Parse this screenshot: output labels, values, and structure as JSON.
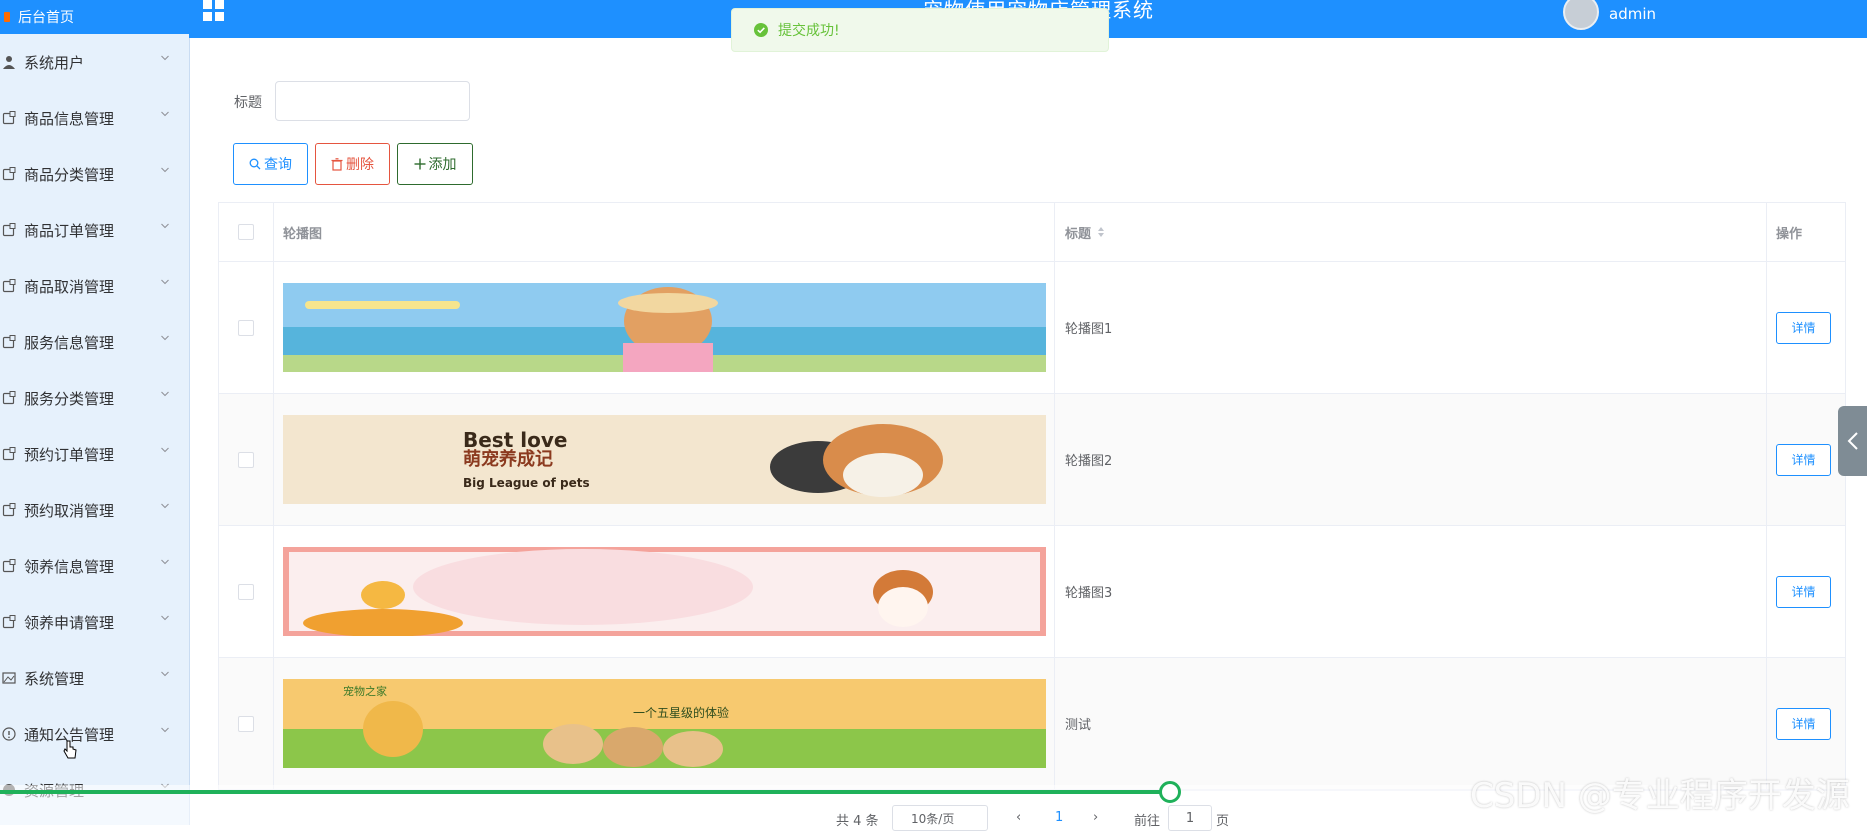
{
  "sidebar": {
    "home_label": "后台首页",
    "items": [
      {
        "label": "系统用户",
        "icon": "user-icon"
      },
      {
        "label": "商品信息管理",
        "icon": "doc-icon"
      },
      {
        "label": "商品分类管理",
        "icon": "doc-icon"
      },
      {
        "label": "商品订单管理",
        "icon": "doc-icon"
      },
      {
        "label": "商品取消管理",
        "icon": "doc-icon"
      },
      {
        "label": "服务信息管理",
        "icon": "doc-icon"
      },
      {
        "label": "服务分类管理",
        "icon": "doc-icon"
      },
      {
        "label": "预约订单管理",
        "icon": "doc-icon"
      },
      {
        "label": "预约取消管理",
        "icon": "doc-icon"
      },
      {
        "label": "领养信息管理",
        "icon": "doc-icon"
      },
      {
        "label": "领养申请管理",
        "icon": "doc-icon"
      },
      {
        "label": "系统管理",
        "icon": "picture-icon"
      },
      {
        "label": "通知公告管理",
        "icon": "info-icon"
      },
      {
        "label": "资源管理",
        "icon": "globe-icon"
      }
    ]
  },
  "topbar": {
    "title": "宠物使用宠物店管理系统",
    "user": "admin"
  },
  "toast": {
    "message": "提交成功!"
  },
  "search": {
    "label": "标题",
    "value": ""
  },
  "buttons": {
    "search": "查询",
    "delete": "删除",
    "add": "添加"
  },
  "table": {
    "headers": {
      "image": "轮播图",
      "title": "标题",
      "operation": "操作"
    },
    "rows": [
      {
        "title": "轮播图1",
        "action": "详情"
      },
      {
        "title": "轮播图2",
        "action": "详情",
        "banner_text_1": "Best love",
        "banner_text_2": "萌宠养成记",
        "banner_text_3": "Big League of pets"
      },
      {
        "title": "轮播图3",
        "action": "详情"
      },
      {
        "title": "测试",
        "action": "详情",
        "banner_text_1": "宠物之家",
        "banner_text_2": "一个五星级的体验"
      }
    ]
  },
  "pagination": {
    "total": "共 4 条",
    "page_size": "10条/页",
    "current": "1",
    "goto_prefix": "前往",
    "goto_value": "1",
    "goto_suffix": "页"
  },
  "watermark": "CSDN @专业程序开发源",
  "colors": {
    "primary": "#1e90ff",
    "danger": "#e5553f",
    "success": "#67c23a",
    "progress": "#1fb15a"
  }
}
